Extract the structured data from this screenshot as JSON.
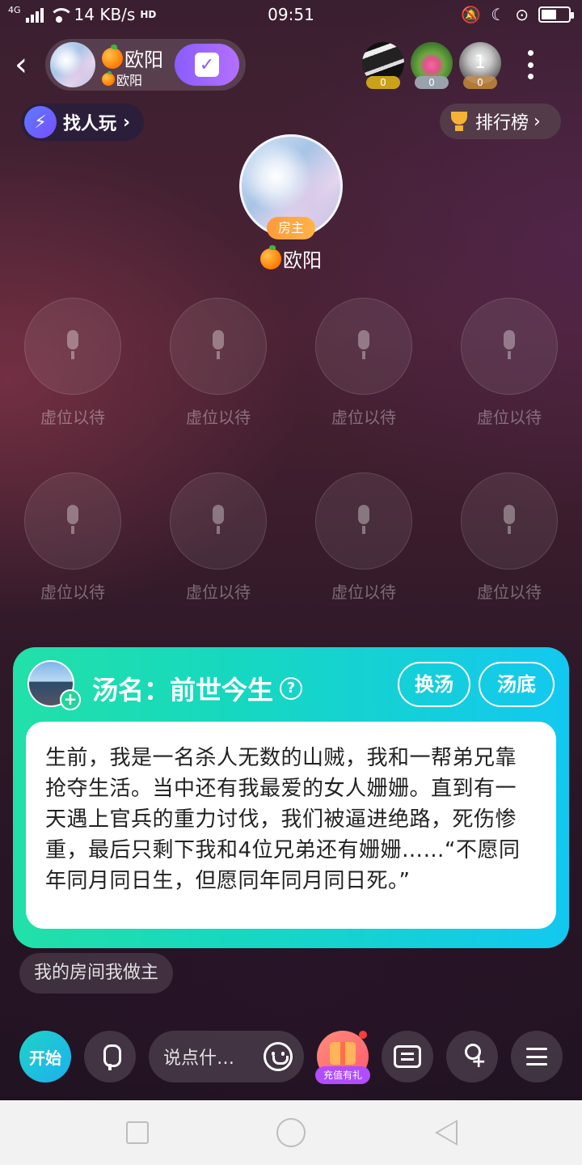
{
  "status_bar": {
    "network": "4G",
    "speed": "14 KB/s",
    "hd": "HD",
    "time": "09:51"
  },
  "header": {
    "host_name": "欧阳",
    "host_sub": "欧阳",
    "audience": [
      {
        "badge": "0",
        "badge_color": "#c9a21a"
      },
      {
        "badge": "0",
        "badge_color": "#9aa3ad"
      },
      {
        "badge": "0",
        "badge_color": "#b07a3a"
      }
    ],
    "audience_count": "1"
  },
  "actions": {
    "find_label": "找人玩",
    "rank_label": "排行榜"
  },
  "owner": {
    "tag": "房主",
    "name": "欧阳"
  },
  "seats": [
    {
      "label": "虚位以待"
    },
    {
      "label": "虚位以待"
    },
    {
      "label": "虚位以待"
    },
    {
      "label": "虚位以待"
    },
    {
      "label": "虚位以待"
    },
    {
      "label": "虚位以待"
    },
    {
      "label": "虚位以待"
    },
    {
      "label": "虚位以待"
    }
  ],
  "soup": {
    "title": "汤名：前世今生",
    "help": "?",
    "change_label": "换汤",
    "answer_label": "汤底",
    "text": "生前，我是一名杀人无数的山贼，我和一帮弟兄靠抢夺生活。当中还有我最爱的女人姗姗。直到有一天遇上官兵的重力讨伐，我们被逼进绝路，死伤惨重，最后只剩下我和4位兄弟还有姗姗……“不愿同年同月同日生，但愿同年同月同日死。”"
  },
  "chip": "我的房间我做主",
  "toolbar": {
    "start_label": "开始",
    "input_placeholder": "说点什…",
    "gift_label": "充值有礼"
  },
  "colors": {
    "accent_purple": "#8a5cff",
    "soup_gradient_start": "#22e0a8",
    "soup_gradient_end": "#13c8f0"
  }
}
